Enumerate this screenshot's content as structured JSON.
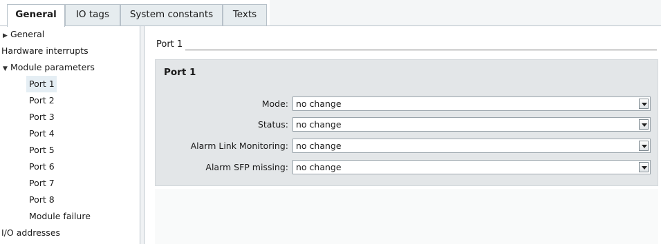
{
  "tabs": [
    {
      "label": "General",
      "active": true
    },
    {
      "label": "IO tags",
      "active": false
    },
    {
      "label": "System constants",
      "active": false
    },
    {
      "label": "Texts",
      "active": false
    }
  ],
  "nav": {
    "items": [
      {
        "label": "General",
        "icon": "triangle-right-icon"
      },
      {
        "label": "Hardware interrupts"
      },
      {
        "label": "Module parameters",
        "icon": "triangle-down-icon"
      },
      {
        "label": "Port 1",
        "selected": true
      },
      {
        "label": "Port 2"
      },
      {
        "label": "Port 3"
      },
      {
        "label": "Port 4"
      },
      {
        "label": "Port 5"
      },
      {
        "label": "Port 6"
      },
      {
        "label": "Port 7"
      },
      {
        "label": "Port 8"
      },
      {
        "label": "Module failure"
      },
      {
        "label": "I/O addresses"
      }
    ]
  },
  "content": {
    "section_title": "Port 1",
    "group_title": "Port 1",
    "fields": [
      {
        "label": "Mode:",
        "value": "no change"
      },
      {
        "label": "Status:",
        "value": "no change"
      },
      {
        "label": "Alarm Link Monitoring:",
        "value": "no change"
      },
      {
        "label": "Alarm SFP missing:",
        "value": "no change"
      }
    ]
  },
  "colors": {
    "selected_row": "#e5eef4",
    "group_background": "#e3e6e8",
    "tab_inactive": "#e6ecef"
  }
}
